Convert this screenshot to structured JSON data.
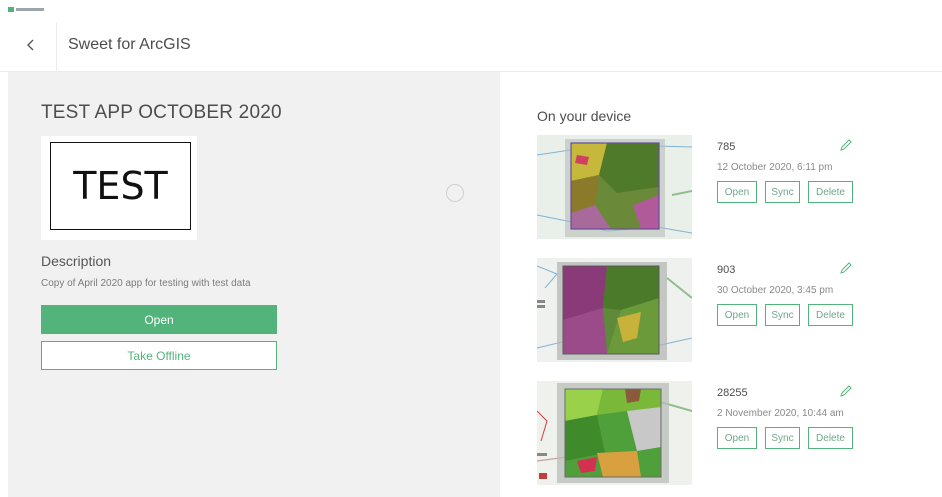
{
  "header": {
    "app_title": "Sweet for ArcGIS"
  },
  "app": {
    "title": "TEST APP OCTOBER 2020",
    "thumbnail_text": "TEST",
    "description_label": "Description",
    "description": "Copy of April 2020 app for testing with test data",
    "open_label": "Open",
    "offline_label": "Take Offline"
  },
  "device": {
    "section_title": "On your device",
    "items": [
      {
        "name": "785",
        "date": "12 October 2020, 6:11 pm",
        "open": "Open",
        "sync": "Sync",
        "delete": "Delete"
      },
      {
        "name": "903",
        "date": "30 October 2020, 3:45 pm",
        "open": "Open",
        "sync": "Sync",
        "delete": "Delete"
      },
      {
        "name": "28255",
        "date": "2 November 2020, 10:44 am",
        "open": "Open",
        "sync": "Sync",
        "delete": "Delete"
      }
    ]
  },
  "colors": {
    "accent": "#52b47b",
    "panel_bg": "#f2f1f1"
  },
  "icons": {
    "back": "chevron-left-icon",
    "edit": "pencil-icon"
  }
}
